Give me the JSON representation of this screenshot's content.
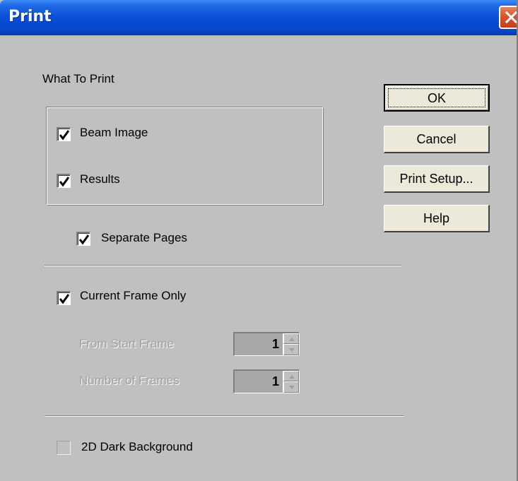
{
  "window": {
    "title": "Print"
  },
  "what_to_print": {
    "label": "What To Print",
    "beam_image": {
      "label": "Beam Image",
      "checked": true
    },
    "results": {
      "label": "Results",
      "checked": true
    },
    "separate_pages": {
      "label": "Separate Pages",
      "checked": true
    }
  },
  "frames": {
    "current_frame_only": {
      "label": "Current Frame Only",
      "checked": true
    },
    "from_start_frame": {
      "label": "From Start Frame",
      "value": "1"
    },
    "number_of_frames": {
      "label": "Number of Frames",
      "value": "1"
    }
  },
  "dark_background": {
    "label": "2D Dark Background",
    "checked": false
  },
  "buttons": {
    "ok": "OK",
    "cancel": "Cancel",
    "print_setup": "Print Setup...",
    "help": "Help"
  },
  "icons": {
    "close": "close-icon",
    "check": "checkmark-icon",
    "spin_up": "arrow-up-icon",
    "spin_down": "arrow-down-icon"
  },
  "colors": {
    "titlebar": "#0a4fd8",
    "close_button": "#d8542c",
    "dialog_background": "#c0c0c0",
    "button_face": "#ece9d8"
  }
}
